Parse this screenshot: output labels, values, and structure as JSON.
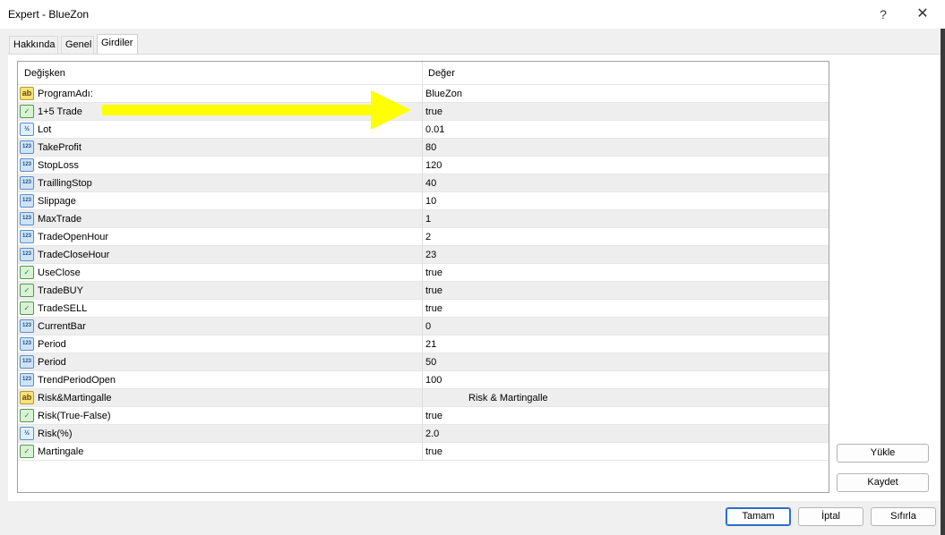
{
  "window": {
    "title": "Expert - BlueZon",
    "help_label": "?",
    "close_label": "✕"
  },
  "tabs": [
    {
      "label": "Hakkında"
    },
    {
      "label": "Genel"
    },
    {
      "label": "Girdiler"
    }
  ],
  "table": {
    "col_variable": "Değişken",
    "col_value": "Değer",
    "rows": [
      {
        "icon": "ab",
        "name": "ProgramAdı:",
        "value": "BlueZon"
      },
      {
        "icon": "bool",
        "name": "1+5 Trade",
        "value": "true"
      },
      {
        "icon": "frac",
        "name": "Lot",
        "value": "0.01"
      },
      {
        "icon": "num",
        "name": "TakeProfit",
        "value": "80"
      },
      {
        "icon": "num",
        "name": "StopLoss",
        "value": "120"
      },
      {
        "icon": "num",
        "name": "TraillingStop",
        "value": "40"
      },
      {
        "icon": "num",
        "name": "Slippage",
        "value": "10"
      },
      {
        "icon": "num",
        "name": "MaxTrade",
        "value": "1"
      },
      {
        "icon": "num",
        "name": "TradeOpenHour",
        "value": "2"
      },
      {
        "icon": "num",
        "name": "TradeCloseHour",
        "value": "23"
      },
      {
        "icon": "bool",
        "name": "UseClose",
        "value": "true"
      },
      {
        "icon": "bool",
        "name": "TradeBUY",
        "value": "true"
      },
      {
        "icon": "bool",
        "name": "TradeSELL",
        "value": "true"
      },
      {
        "icon": "num",
        "name": "CurrentBar",
        "value": "0"
      },
      {
        "icon": "num",
        "name": "Period",
        "value": "21"
      },
      {
        "icon": "num",
        "name": "Period",
        "value": "50"
      },
      {
        "icon": "num",
        "name": "TrendPeriodOpen",
        "value": "100"
      },
      {
        "icon": "ab",
        "name": "Risk&Martingalle",
        "value": "Risk & Martingalle"
      },
      {
        "icon": "bool",
        "name": "Risk(True-False)",
        "value": "true"
      },
      {
        "icon": "frac",
        "name": "Risk(%)",
        "value": "2.0"
      },
      {
        "icon": "bool",
        "name": "Martingale",
        "value": "true"
      }
    ]
  },
  "icon_glyphs": {
    "ab": "ab",
    "num": "123",
    "frac": "½",
    "bool": "✓"
  },
  "side_buttons": {
    "load": "Yükle",
    "save": "Kaydet"
  },
  "bottom_buttons": {
    "ok": "Tamam",
    "cancel": "İptal",
    "reset": "Sıfırla"
  },
  "annotation": {
    "arrow_color": "#ffff00"
  }
}
